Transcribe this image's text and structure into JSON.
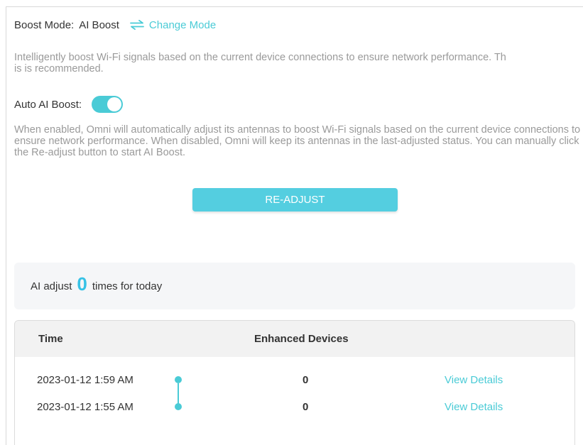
{
  "mode": {
    "label": "Boost Mode:",
    "value": "AI Boost",
    "change_label": "Change Mode",
    "change_icon": "swap-arrows-icon"
  },
  "description": {
    "line1": "Intelligently boost Wi-Fi signals based on the current device connections to ensure network performance. Th",
    "line2": "is is recommended."
  },
  "auto_boost": {
    "label": "Auto AI Boost:",
    "enabled": true,
    "description": "When enabled, Omni will automatically adjust its antennas to boost Wi-Fi signals based on the current device connections to ensure network performance. When disabled, Omni will keep its antennas in the last-adjusted status. You can manually click the Re-adjust button to start AI Boost."
  },
  "readjust_button": "RE-ADJUST",
  "adjust_summary": {
    "prefix": "AI adjust",
    "count": "0",
    "suffix": "times for today"
  },
  "history_table": {
    "headers": {
      "time": "Time",
      "devices": "Enhanced Devices"
    },
    "rows": [
      {
        "time": "2023-01-12 1:59 AM",
        "devices": "0",
        "link": "View Details"
      },
      {
        "time": "2023-01-12 1:55 AM",
        "devices": "0",
        "link": "View Details"
      }
    ]
  },
  "colors": {
    "accent": "#4acbd6",
    "button": "#54cee0",
    "count": "#37c2e6",
    "muted_text": "#9a9a9a"
  }
}
